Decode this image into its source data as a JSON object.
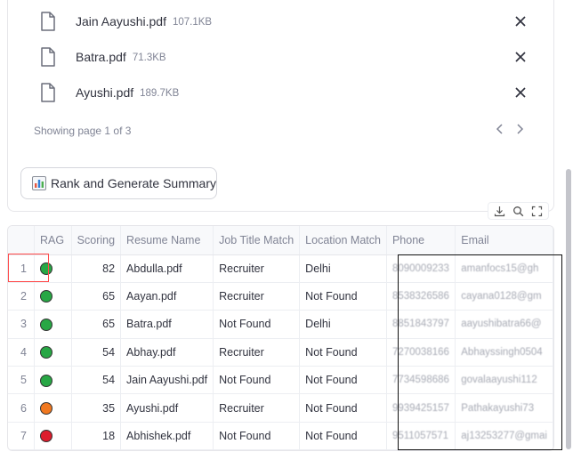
{
  "uploader": {
    "files": [
      {
        "name": "Jain Aayushi.pdf",
        "size": "107.1KB"
      },
      {
        "name": "Batra.pdf",
        "size": "71.3KB"
      },
      {
        "name": "Ayushi.pdf",
        "size": "189.7KB"
      }
    ],
    "pager_text": "Showing page 1 of 3"
  },
  "rank_button": {
    "icon": "bar-chart-icon",
    "label": "Rank and Generate Summary"
  },
  "toolbar": {
    "icons": [
      "download-icon",
      "search-icon",
      "fullscreen-icon"
    ]
  },
  "table": {
    "columns": [
      "",
      "RAG",
      "Scoring",
      "Resume Name",
      "Job Title Match",
      "Location Match",
      "Phone",
      "Email"
    ],
    "rows": [
      {
        "index": "1",
        "rag": "#28a745",
        "score": "82",
        "resume": "Abdulla.pdf",
        "title_match": "Recruiter",
        "location_match": "Delhi",
        "phone": "8090009233",
        "email": "amanfocs15@gh"
      },
      {
        "index": "2",
        "rag": "#28a745",
        "score": "65",
        "resume": "Aayan.pdf",
        "title_match": "Recruiter",
        "location_match": "Not Found",
        "phone": "8538326586",
        "email": "cayana0128@gm"
      },
      {
        "index": "3",
        "rag": "#28a745",
        "score": "65",
        "resume": "Batra.pdf",
        "title_match": "Not Found",
        "location_match": "Delhi",
        "phone": "8851843797",
        "email": "aayushibatra66@"
      },
      {
        "index": "4",
        "rag": "#28a745",
        "score": "54",
        "resume": "Abhay.pdf",
        "title_match": "Recruiter",
        "location_match": "Not Found",
        "phone": "7270038166",
        "email": "Abhayssingh0504"
      },
      {
        "index": "5",
        "rag": "#28a745",
        "score": "54",
        "resume": "Jain Aayushi.pdf",
        "title_match": "Not Found",
        "location_match": "Not Found",
        "phone": "7734598686",
        "email": "govalaayushi112"
      },
      {
        "index": "6",
        "rag": "#f07820",
        "score": "35",
        "resume": "Ayushi.pdf",
        "title_match": "Recruiter",
        "location_match": "Not Found",
        "phone": "9939425157",
        "email": "Pathakayushi73"
      },
      {
        "index": "7",
        "rag": "#dc1c2c",
        "score": "18",
        "resume": "Abhishek.pdf",
        "title_match": "Not Found",
        "location_match": "Not Found",
        "phone": "9511057571",
        "email": "aj13253277@gmai"
      }
    ]
  }
}
